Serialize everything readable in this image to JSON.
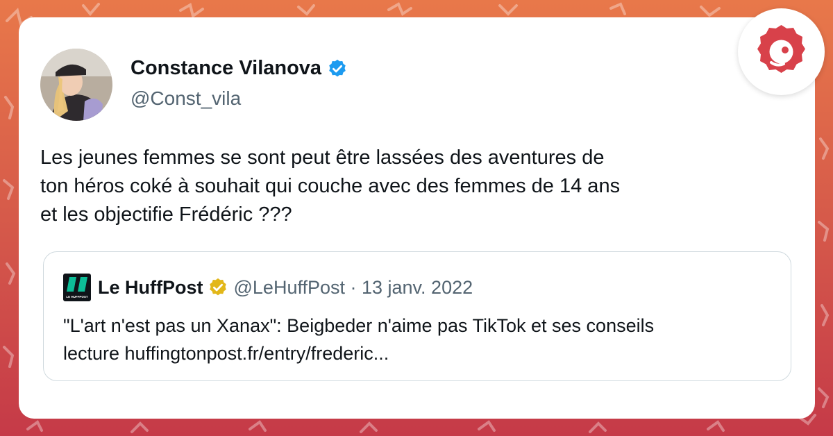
{
  "tweet": {
    "author_name": "Constance Vilanova",
    "author_handle": "@Const_vila",
    "text_lines": [
      "Les jeunes femmes se sont peut être lassées des aventures de",
      "ton héros coké à souhait qui couche avec des femmes de 14 ans",
      "et les objectifie Frédéric ???"
    ],
    "verified_color": "#1d9bf0"
  },
  "quoted": {
    "name": "Le HuffPost",
    "logo_text": "LE HUFFPOST",
    "meta": "@LeHuffPost · 13 janv. 2022",
    "text_lines": [
      "\"L'art n'est pas un Xanax\": Beigbeder n'aime pas TikTok et ses conseils",
      "lecture huffingtonpost.fr/entry/frederic..."
    ],
    "badge_color": "#e2b719",
    "logo_color": "#0dbe98"
  },
  "brand": {
    "icon": "brand-logo-icon",
    "color": "#d8414a"
  },
  "colors": {
    "background_top": "#e8784a",
    "background_bottom": "#c53a48"
  }
}
